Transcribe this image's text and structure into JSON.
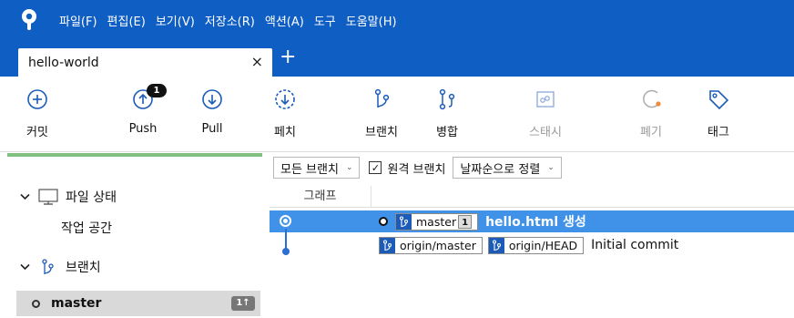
{
  "menu": [
    {
      "id": "file",
      "label": "파일(F)"
    },
    {
      "id": "edit",
      "label": "편집(E)"
    },
    {
      "id": "view",
      "label": "보기(V)"
    },
    {
      "id": "repo",
      "label": "저장소(R)"
    },
    {
      "id": "action",
      "label": "액션(A)"
    },
    {
      "id": "tools",
      "label": "도구"
    },
    {
      "id": "help",
      "label": "도움말(H)"
    }
  ],
  "tab": {
    "title": "hello-world",
    "close": "×",
    "add": "+"
  },
  "toolbar": {
    "commit": "커밋",
    "push": "Push",
    "push_badge": "1",
    "pull": "Pull",
    "fetch": "페치",
    "branch": "브랜치",
    "merge": "병합",
    "stash": "스태시",
    "discard": "폐기",
    "tag": "태그"
  },
  "sidebar": {
    "progress": 1.0,
    "file_status": "파일 상태",
    "workspace": "작업 공간",
    "branches": "브랜치",
    "current_branch": "master",
    "current_branch_badge": "1↑"
  },
  "filters": {
    "branch_filter": "모든 브랜치",
    "remote_checkbox": "원격 브랜치",
    "remote_checked": true,
    "sort": "날짜순으로 정렬"
  },
  "columns": {
    "graph": "그래프"
  },
  "commits": [
    {
      "selected": true,
      "refs": [
        {
          "name": "master",
          "ahead": "1"
        }
      ],
      "message": "hello.html 생성"
    },
    {
      "selected": false,
      "refs": [
        {
          "name": "origin/master"
        },
        {
          "name": "origin/HEAD"
        }
      ],
      "message": "Initial commit"
    }
  ],
  "colors": {
    "titlebar": "#0f5ec4",
    "selection": "#3f92e8",
    "graph": "#2c6fd1",
    "ref_icon": "#1c5bb8"
  }
}
